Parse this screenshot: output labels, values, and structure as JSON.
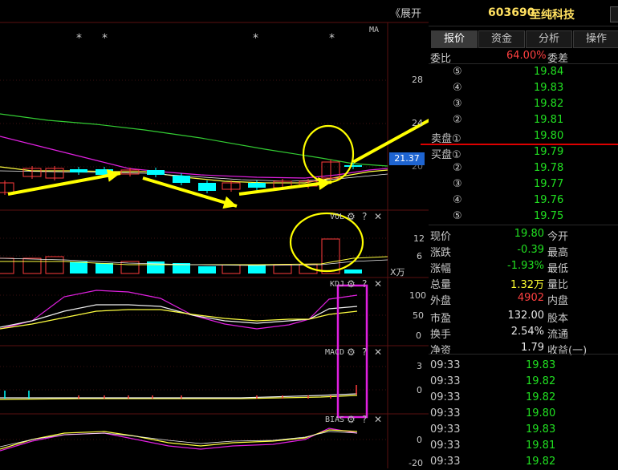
{
  "top_bar": {
    "expand_label": "《展开",
    "code": "603690",
    "name": "至纯科技"
  },
  "tabs": [
    "报价",
    "资金",
    "分析",
    "操作"
  ],
  "ratio": {
    "label": "委比",
    "value": "64.00%",
    "label2": "委差"
  },
  "asks": [
    {
      "level": "⑤",
      "price": "19.84"
    },
    {
      "level": "④",
      "price": "19.83"
    },
    {
      "level": "③",
      "price": "19.82"
    },
    {
      "level": "②",
      "price": "19.81"
    },
    {
      "level": "卖盘①",
      "price": "19.80"
    }
  ],
  "bids": [
    {
      "level": "买盘①",
      "price": "19.79"
    },
    {
      "level": "②",
      "price": "19.78"
    },
    {
      "level": "③",
      "price": "19.77"
    },
    {
      "level": "④",
      "price": "19.76"
    },
    {
      "level": "⑤",
      "price": "19.75"
    }
  ],
  "stats": [
    {
      "label": "现价",
      "value": "19.80",
      "label2": "今开",
      "color": "green"
    },
    {
      "label": "涨跌",
      "value": "-0.39",
      "label2": "最高",
      "color": "green"
    },
    {
      "label": "涨幅",
      "value": "-1.93%",
      "label2": "最低",
      "color": "green"
    },
    {
      "label": "总量",
      "value": "1.32万",
      "label2": "量比",
      "color": "yellow"
    },
    {
      "label": "外盘",
      "value": "4902",
      "label2": "内盘",
      "color": "red"
    },
    {
      "label": "市盈",
      "value": "132.00",
      "label2": "股本",
      "color": "white"
    },
    {
      "label": "换手",
      "value": "2.54%",
      "label2": "流通",
      "color": "white"
    },
    {
      "label": "净资",
      "value": "1.79",
      "label2": "收益(一)",
      "color": "white"
    }
  ],
  "ticks": [
    {
      "time": "09:33",
      "price": "19.83"
    },
    {
      "time": "09:33",
      "price": "19.82"
    },
    {
      "time": "09:33",
      "price": "19.82"
    },
    {
      "time": "09:33",
      "price": "19.80"
    },
    {
      "time": "09:33",
      "price": "19.83"
    },
    {
      "time": "09:33",
      "price": "19.81"
    },
    {
      "time": "09:33",
      "price": "19.82"
    }
  ],
  "chart": {
    "ma_label": "MA",
    "price_ticks": [
      "28",
      "24",
      "20"
    ],
    "current_price_tag": "21.37",
    "vol_label": "VOL",
    "vol_ticks": [
      "12",
      "6"
    ],
    "vol_unit": "X万",
    "kdj_label": "KDJ",
    "kdj_ticks": [
      "100",
      "50",
      "0"
    ],
    "macd_label": "MACD",
    "macd_ticks": [
      "3",
      "0"
    ],
    "bias_label": "BIAS",
    "bias_ticks": [
      "0",
      "-20"
    ],
    "stars": [
      "*",
      "*",
      "*",
      "*"
    ],
    "icon_glyphs": {
      "gear": "⚙",
      "help": "?",
      "close": "✕"
    },
    "colors": {
      "up": "#ff3c3c",
      "down": "#00ffff",
      "ma_green": "#33cc33",
      "ma_magenta": "#e020e0",
      "ma_yellow": "#ffff40",
      "arrow": "#ffff00",
      "circle": "#ffff00",
      "highlight": "#e020e0",
      "red_line": "#dd0000"
    }
  }
}
